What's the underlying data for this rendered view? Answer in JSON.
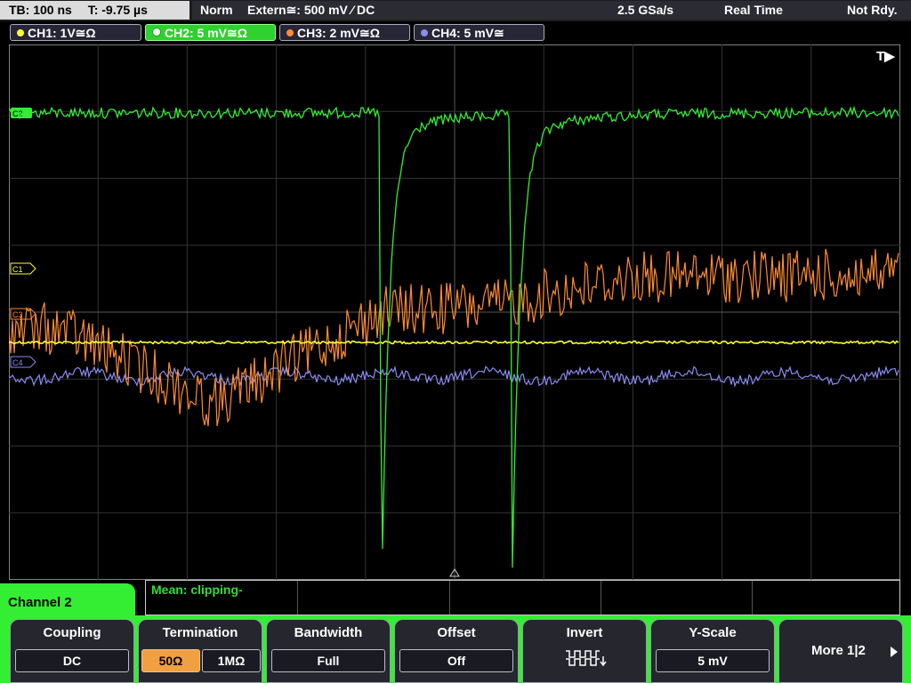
{
  "status": {
    "timebase": "TB: 100 ns",
    "trigger_time": "T: -9.75 µs",
    "mode": "Norm",
    "trigger_source": "Extern≅: 500 mV ⁄ DC",
    "sample_rate": "2.5 GSa/s",
    "acquisition": "Real Time",
    "state": "Not Rdy."
  },
  "channels": [
    {
      "label": "CH1: 1V≅Ω",
      "color": "#ffff33"
    },
    {
      "label": "CH2: 5 mV≅Ω",
      "color": "#33ee33"
    },
    {
      "label": "CH3: 2 mV≅Ω",
      "color": "#ff8c33"
    },
    {
      "label": "CH4: 5 mV≅",
      "color": "#8a8cf0"
    }
  ],
  "screen": {
    "trigger_marker": "T▶",
    "markers": {
      "c1": "C1",
      "c2": "C2",
      "c3": "C3",
      "c4": "C4"
    }
  },
  "measurement": {
    "text": "Mean: clipping-"
  },
  "channel_label": "Channel 2",
  "softkeys": {
    "coupling": {
      "title": "Coupling",
      "value": "DC"
    },
    "termination": {
      "title": "Termination",
      "opt1": "50Ω",
      "opt2": "1MΩ"
    },
    "bandwidth": {
      "title": "Bandwidth",
      "value": "Full"
    },
    "offset": {
      "title": "Offset",
      "value": "Off"
    },
    "invert": {
      "title": "Invert"
    },
    "yscale": {
      "title": "Y-Scale",
      "value": "5 mV"
    },
    "more": {
      "label": "More 1|2"
    }
  }
}
